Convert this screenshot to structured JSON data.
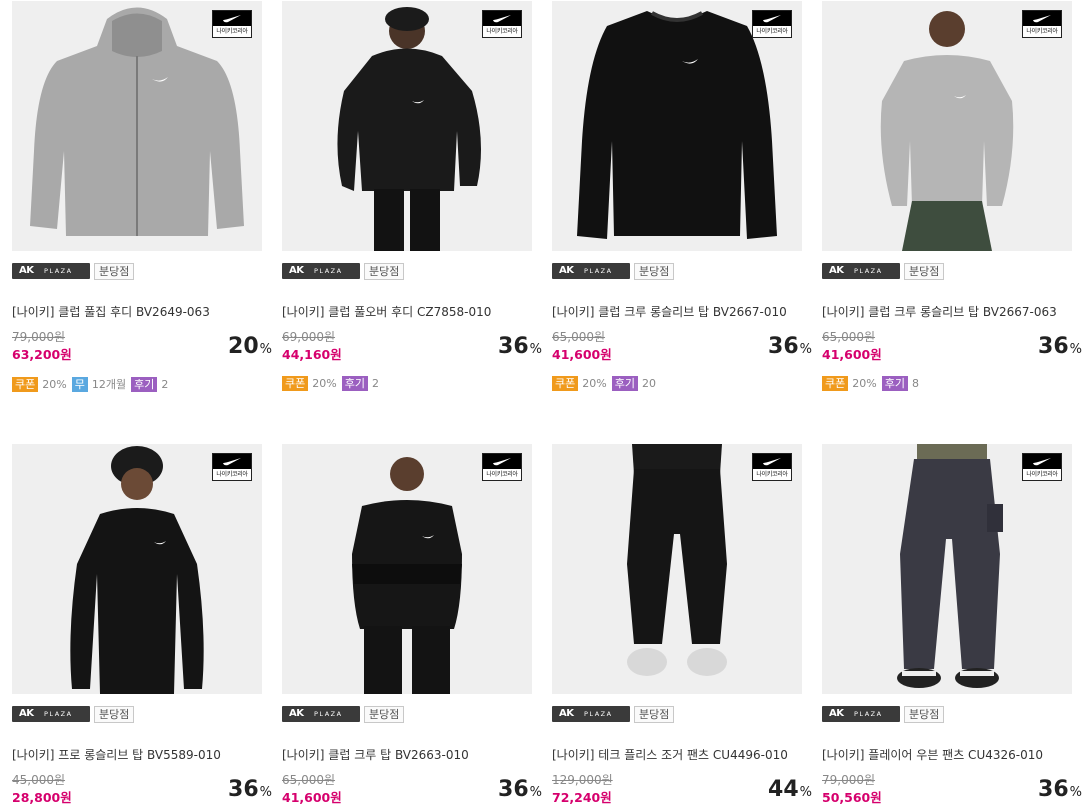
{
  "badge_text": "나이키코리아",
  "store_logo": {
    "ak": "AK",
    "plaza": "PLAZA"
  },
  "colors": {
    "sale_price": "#d6006d",
    "coupon": "#f09a1c",
    "free_shipping": "#5aa8e0",
    "review": "#9b5fc0"
  },
  "products": [
    {
      "name": "[나이키] 클럽 풀집 후디 BV2649-063",
      "branch": "분당점",
      "original_price": "79,000원",
      "sale_price": "63,200원",
      "discount": "20",
      "pct": "%",
      "coupon_label": "쿠폰",
      "coupon_value": "20%",
      "free_label": "무",
      "free_value": "12개월",
      "review_label": "후기",
      "review_count": "2"
    },
    {
      "name": "[나이키] 클럽 풀오버 후디 CZ7858-010",
      "branch": "분당점",
      "original_price": "69,000원",
      "sale_price": "44,160원",
      "discount": "36",
      "pct": "%",
      "coupon_label": "쿠폰",
      "coupon_value": "20%",
      "review_label": "후기",
      "review_count": "2"
    },
    {
      "name": "[나이키] 클럽 크루 롱슬리브 탑 BV2667-010",
      "branch": "분당점",
      "original_price": "65,000원",
      "sale_price": "41,600원",
      "discount": "36",
      "pct": "%",
      "coupon_label": "쿠폰",
      "coupon_value": "20%",
      "review_label": "후기",
      "review_count": "20"
    },
    {
      "name": "[나이키] 클럽 크루 롱슬리브 탑 BV2667-063",
      "branch": "분당점",
      "original_price": "65,000원",
      "sale_price": "41,600원",
      "discount": "36",
      "pct": "%",
      "coupon_label": "쿠폰",
      "coupon_value": "20%",
      "review_label": "후기",
      "review_count": "8"
    },
    {
      "name": "[나이키] 프로 롱슬리브 탑 BV5589-010",
      "branch": "분당점",
      "original_price": "45,000원",
      "sale_price": "28,800원",
      "discount": "36",
      "pct": "%"
    },
    {
      "name": "[나이키] 클럽 크루 탑 BV2663-010",
      "branch": "분당점",
      "original_price": "65,000원",
      "sale_price": "41,600원",
      "discount": "36",
      "pct": "%"
    },
    {
      "name": "[나이키] 테크 플리스 조거 팬츠 CU4496-010",
      "branch": "분당점",
      "original_price": "129,000원",
      "sale_price": "72,240원",
      "discount": "44",
      "pct": "%"
    },
    {
      "name": "[나이키] 플레이어 우븐 팬츠 CU4326-010",
      "branch": "분당점",
      "original_price": "79,000원",
      "sale_price": "50,560원",
      "discount": "36",
      "pct": "%"
    }
  ]
}
